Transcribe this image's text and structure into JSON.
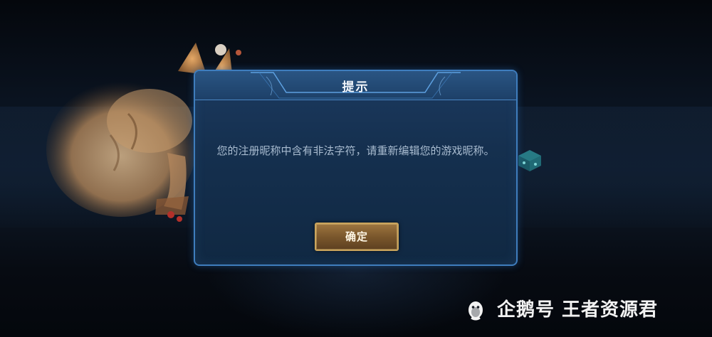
{
  "dialog": {
    "title": "提示",
    "message": "您的注册昵称中含有非法字符，请重新编辑您的游戏昵称。",
    "confirm_label": "确定"
  },
  "watermark": {
    "text": "企鹅号 王者资源君",
    "icon": "penguin-icon"
  },
  "colors": {
    "dialog_border": "#3f7dbd",
    "dialog_bg": "#15304f",
    "button_gold": "#c9a45c",
    "message_text": "#a9bcd0"
  }
}
